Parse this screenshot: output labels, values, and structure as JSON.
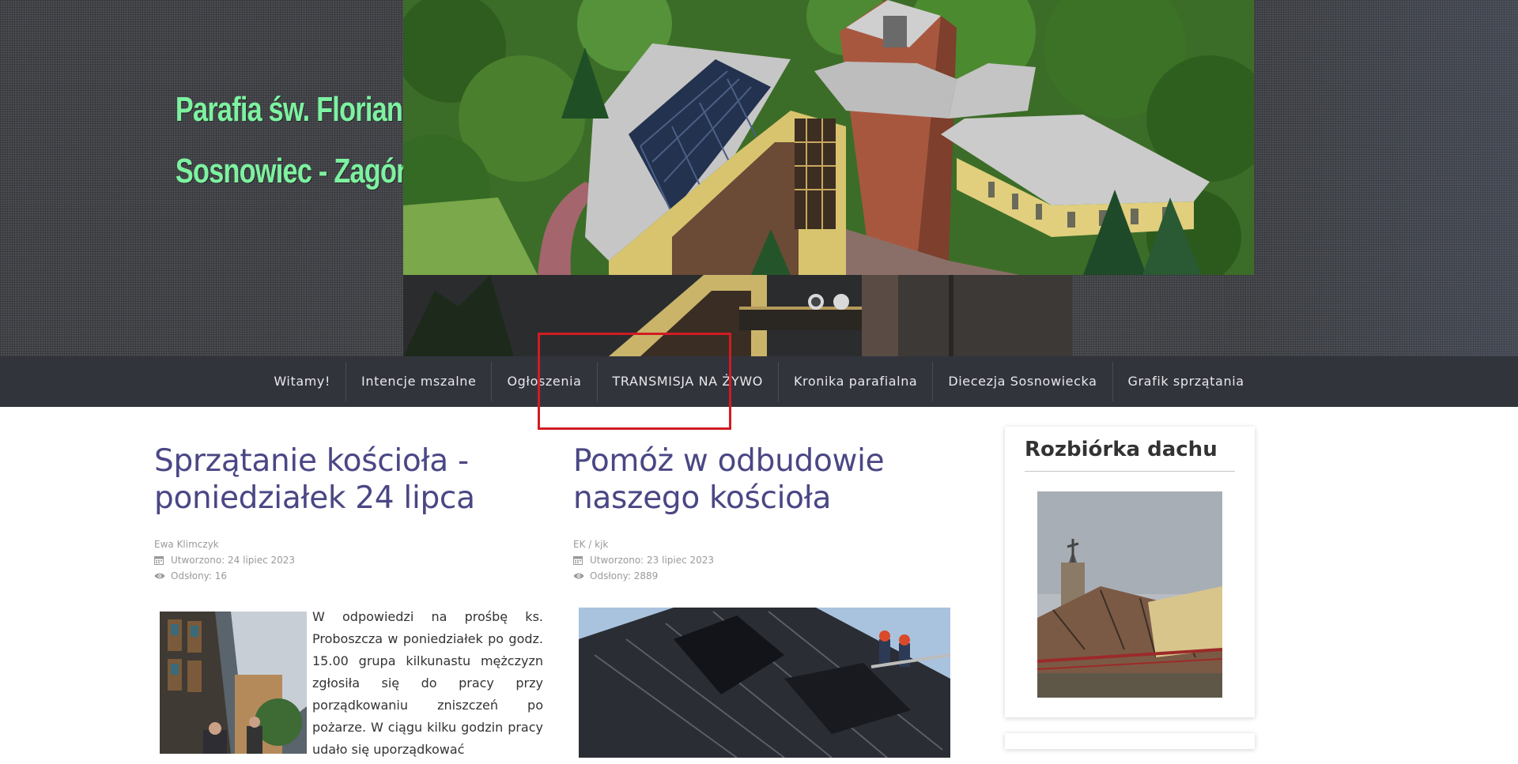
{
  "site": {
    "title_line1": "Parafia św. Floriana",
    "title_line2": "Sosnowiec - Zagórze"
  },
  "slider": {
    "slides": 2,
    "active_index": 0
  },
  "nav": {
    "items": [
      {
        "label": "Witamy!"
      },
      {
        "label": "Intencje mszalne"
      },
      {
        "label": "Ogłoszenia"
      },
      {
        "label": "TRANSMISJA NA ŻYWO"
      },
      {
        "label": "Kronika parafialna"
      },
      {
        "label": "Diecezja Sosnowiecka"
      },
      {
        "label": "Grafik sprzątania"
      }
    ],
    "highlighted": "TRANSMISJA NA ŻYWO"
  },
  "articles": [
    {
      "title": "Sprzątanie kościoła - poniedziałek 24 lipca",
      "author": "Ewa Klimczyk",
      "created": "Utworzono: 24 lipiec 2023",
      "views": "Odsłony: 16",
      "body": "W odpowiedzi na prośbę ks. Proboszcza w poniedziałek po godz. 15.00 grupa kilkunastu mężczyzn zgłosiła się do pracy przy porządkowaniu zniszczeń po pożarze. W ciągu kilku godzin pracy udało się uporządkować"
    },
    {
      "title": "Pomóż w odbudowie naszego kościoła",
      "author": "EK / kjk",
      "created": "Utworzono: 23 lipiec 2023",
      "views": "Odsłony: 2889"
    }
  ],
  "sidebar": {
    "widget_title": "Rozbiórka dachu"
  },
  "icons": {
    "calendar": "calendar-icon",
    "views": "eye-icon"
  },
  "colors": {
    "title_green": "#7df2a0",
    "nav_bg": "#32343c",
    "article_title": "#4a4785",
    "highlight": "#d01c22"
  }
}
